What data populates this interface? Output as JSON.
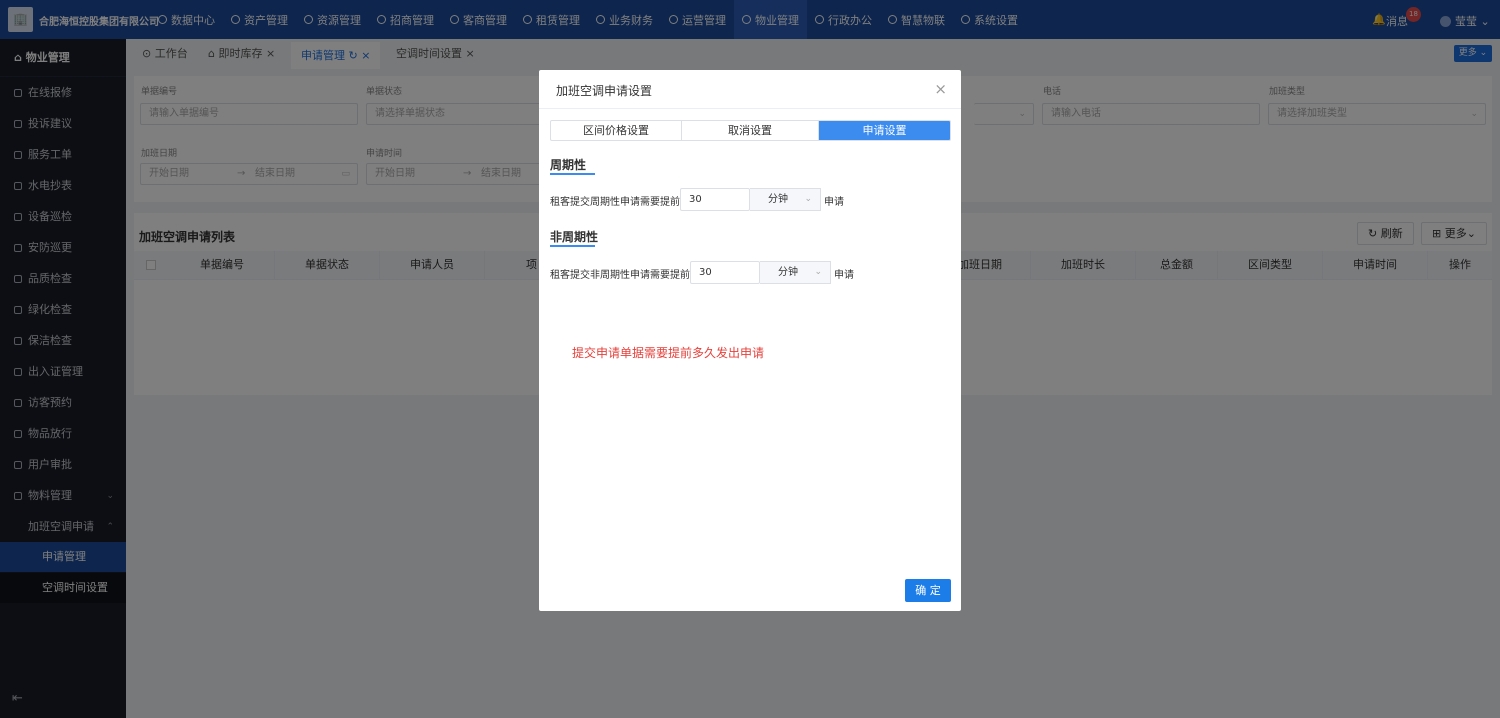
{
  "header": {
    "company": "合肥海恒控股集团有限公司",
    "logo_glyph": "🏢",
    "nav": [
      "数据中心",
      "资产管理",
      "资源管理",
      "招商管理",
      "客商管理",
      "租赁管理",
      "业务财务",
      "运营管理",
      "物业管理",
      "行政办公",
      "智慧物联",
      "系统设置"
    ],
    "active_nav_index": 8,
    "bell_glyph": "🔔",
    "messages_label": "消息",
    "messages_count": "18",
    "user_name": "莹莹"
  },
  "sidebar": {
    "title": "物业管理",
    "items": [
      "在线报修",
      "投诉建议",
      "服务工单",
      "水电抄表",
      "设备巡检",
      "安防巡更",
      "品质检查",
      "绿化检查",
      "保洁检查",
      "出入证管理",
      "访客预约",
      "物品放行",
      "用户审批",
      "物料管理",
      "加班空调申请"
    ],
    "submenu": [
      "申请管理",
      "空调时间设置"
    ],
    "active_submenu_index": 0,
    "collapse_glyph": "⇤"
  },
  "tabs": {
    "items": [
      "工作台",
      "即时库存",
      "申请管理",
      "空调时间设置"
    ],
    "active_index": 2,
    "more_label": "更多"
  },
  "filters": {
    "doc_no_label": "单据编号",
    "doc_no_placeholder": "请输入单据编号",
    "status_label": "单据状态",
    "status_placeholder": "请选择单据状态",
    "phone_label": "电话",
    "phone_placeholder": "请输入电话",
    "ot_type_label": "加班类型",
    "ot_type_placeholder": "请选择加班类型",
    "ot_date_label": "加班日期",
    "apply_time_label": "申请时间",
    "start_date": "开始日期",
    "end_date": "结束日期",
    "range_arrow": "→"
  },
  "list": {
    "title": "加班空调申请列表",
    "refresh_label": "刷新",
    "more_label": "更多",
    "columns_left": [
      "单据编号",
      "单据状态",
      "申请人员",
      "项"
    ],
    "columns_right": [
      "加班日期",
      "加班时长",
      "总金额",
      "区间类型",
      "申请时间",
      "操作"
    ]
  },
  "dialog": {
    "title": "加班空调申请设置",
    "close_glyph": "×",
    "tabs": [
      "区间价格设置",
      "取消设置",
      "申请设置"
    ],
    "active_tab": 2,
    "periodic": {
      "title": "周期性",
      "label": "租客提交周期性申请需要提前",
      "value": "30",
      "unit": "分钟",
      "suffix": "申请"
    },
    "non_periodic": {
      "title": "非周期性",
      "label": "租客提交非周期性申请需要提前",
      "value": "30",
      "unit": "分钟",
      "suffix": "申请"
    },
    "hint": "提交申请单据需要提前多久发出申请",
    "confirm_label": "确 定"
  },
  "colors": {
    "topbar": "#1d4a9b",
    "sidebar": "#191d26",
    "accent": "#3c8cf0",
    "hint_red": "#e5413b"
  }
}
